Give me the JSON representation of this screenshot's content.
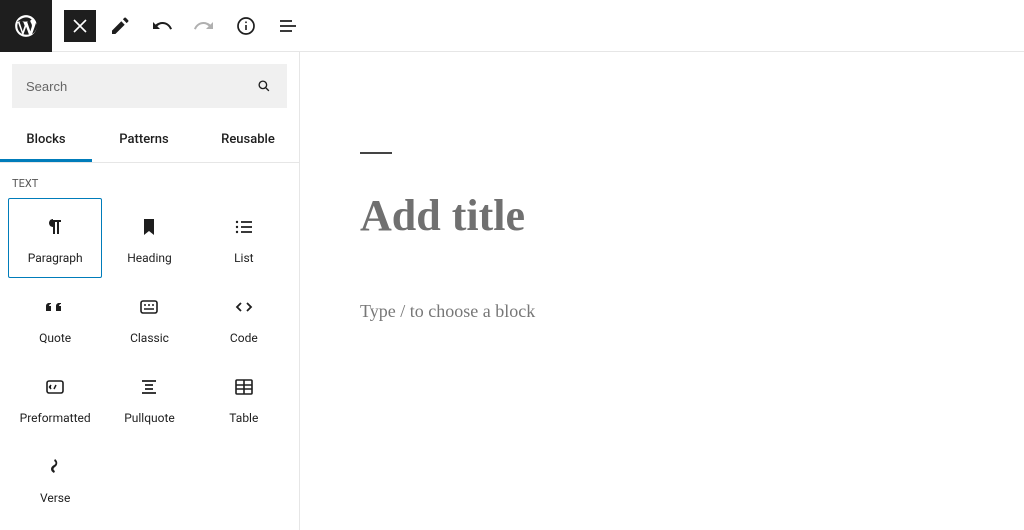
{
  "sidebar": {
    "search_placeholder": "Search",
    "tabs": [
      {
        "label": "Blocks"
      },
      {
        "label": "Patterns"
      },
      {
        "label": "Reusable"
      }
    ],
    "category_label": "TEXT",
    "blocks": [
      {
        "key": "paragraph",
        "label": "Paragraph",
        "selected": true
      },
      {
        "key": "heading",
        "label": "Heading"
      },
      {
        "key": "list",
        "label": "List"
      },
      {
        "key": "quote",
        "label": "Quote"
      },
      {
        "key": "classic",
        "label": "Classic"
      },
      {
        "key": "code",
        "label": "Code"
      },
      {
        "key": "preformatted",
        "label": "Preformatted"
      },
      {
        "key": "pullquote",
        "label": "Pullquote"
      },
      {
        "key": "table",
        "label": "Table"
      },
      {
        "key": "verse",
        "label": "Verse"
      }
    ]
  },
  "editor": {
    "title_placeholder": "Add title",
    "block_placeholder": "Type / to choose a block"
  }
}
